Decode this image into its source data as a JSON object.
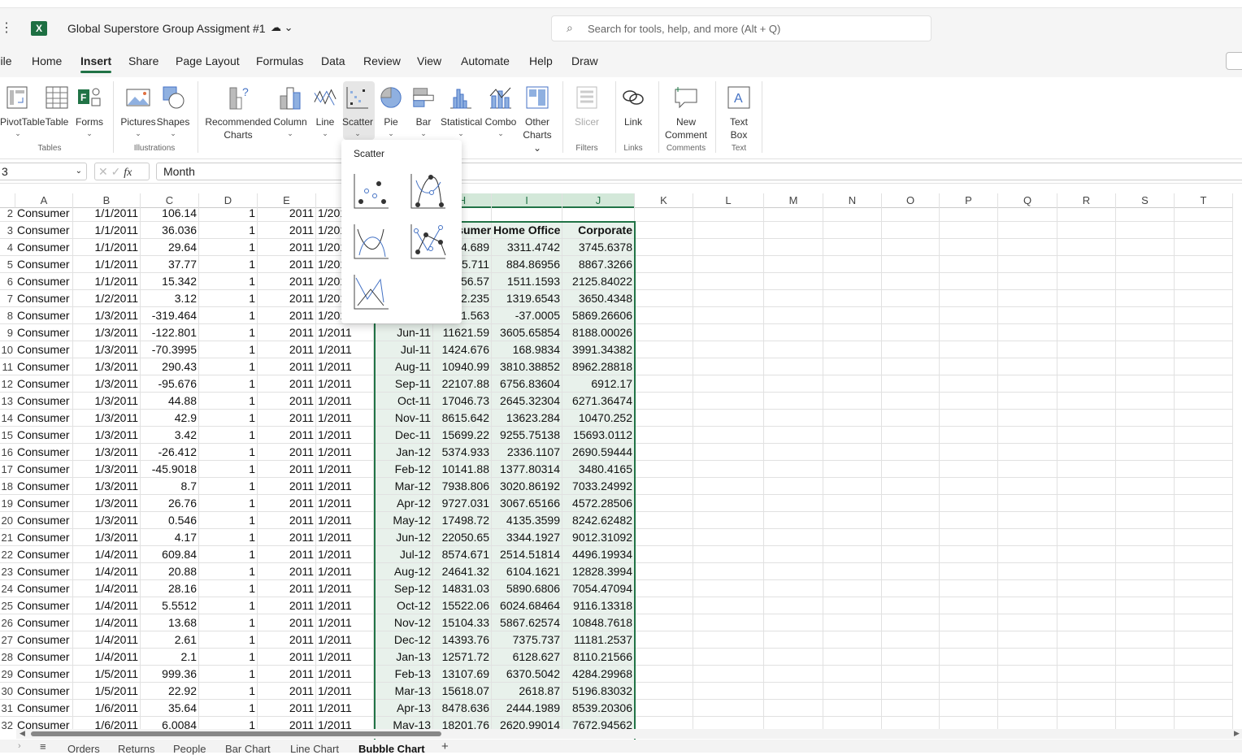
{
  "app": {
    "title": "Global Superstore Group Assigment #1",
    "search_placeholder": "Search for tools, help, and more (Alt + Q)"
  },
  "menu": [
    "File",
    "Home",
    "Insert",
    "Share",
    "Page Layout",
    "Formulas",
    "Data",
    "Review",
    "View",
    "Automate",
    "Help",
    "Draw"
  ],
  "menu_active": "Insert",
  "ribbon": {
    "buttons": [
      {
        "label": "PivotTable",
        "icon": "pivot-table-icon"
      },
      {
        "label": "Table",
        "icon": "table-icon"
      },
      {
        "label": "Forms",
        "icon": "forms-icon"
      },
      {
        "label": "Pictures",
        "icon": "pictures-icon"
      },
      {
        "label": "Shapes",
        "icon": "shapes-icon"
      },
      {
        "label": "Recommended Charts",
        "icon": "recommended-charts-icon"
      },
      {
        "label": "Column",
        "icon": "column-chart-icon"
      },
      {
        "label": "Line",
        "icon": "line-chart-icon"
      },
      {
        "label": "Scatter",
        "icon": "scatter-chart-icon"
      },
      {
        "label": "Pie",
        "icon": "pie-chart-icon"
      },
      {
        "label": "Bar",
        "icon": "bar-chart-icon"
      },
      {
        "label": "Statistical",
        "icon": "statistical-chart-icon"
      },
      {
        "label": "Combo",
        "icon": "combo-chart-icon"
      },
      {
        "label": "Other Charts",
        "icon": "other-charts-icon"
      },
      {
        "label": "Slicer",
        "icon": "slicer-icon"
      },
      {
        "label": "Link",
        "icon": "link-icon"
      },
      {
        "label": "New Comment",
        "icon": "comment-icon"
      },
      {
        "label": "Text Box",
        "icon": "text-box-icon"
      }
    ],
    "groups": [
      "Tables",
      "Illustrations",
      "Filters",
      "Links",
      "Comments",
      "Text"
    ]
  },
  "scatter_menu": {
    "title": "Scatter"
  },
  "formula_bar": {
    "name_box": "3",
    "value": "Month",
    "fx": "fx"
  },
  "columns": [
    "A",
    "B",
    "C",
    "D",
    "E",
    "F",
    "G",
    "H",
    "I",
    "J",
    "K",
    "L",
    "M",
    "N",
    "O",
    "P",
    "Q",
    "R",
    "S",
    "T"
  ],
  "rows": [
    {
      "n": "2",
      "a": "Consumer",
      "b": "1/1/2011",
      "c": "106.14",
      "d": "1",
      "e": "2011",
      "f": "1/2011",
      "g": "",
      "h": "",
      "i": "",
      "j": ""
    },
    {
      "n": "3",
      "a": "Consumer",
      "b": "1/1/2011",
      "c": "36.036",
      "d": "1",
      "e": "2011",
      "f": "1/2011",
      "g": "",
      "h": "Consumer",
      "i": "Home Office",
      "j": "Corporate"
    },
    {
      "n": "4",
      "a": "Consumer",
      "b": "1/1/2011",
      "c": "29.64",
      "d": "1",
      "e": "2011",
      "f": "1/2011",
      "g": "",
      "h": "4.689",
      "i": "3311.4742",
      "j": "3745.6378"
    },
    {
      "n": "5",
      "a": "Consumer",
      "b": "1/1/2011",
      "c": "37.77",
      "d": "1",
      "e": "2011",
      "f": "1/2011",
      "g": "",
      "h": "5.711",
      "i": "884.86956",
      "j": "8867.3266"
    },
    {
      "n": "6",
      "a": "Consumer",
      "b": "1/1/2011",
      "c": "15.342",
      "d": "1",
      "e": "2011",
      "f": "1/2011",
      "g": "",
      "h": "56.57",
      "i": "1511.1593",
      "j": "2125.84022"
    },
    {
      "n": "7",
      "a": "Consumer",
      "b": "1/2/2011",
      "c": "3.12",
      "d": "1",
      "e": "2011",
      "f": "1/2011",
      "g": "",
      "h": "2.235",
      "i": "1319.6543",
      "j": "3650.4348"
    },
    {
      "n": "8",
      "a": "Consumer",
      "b": "1/3/2011",
      "c": "-319.464",
      "d": "1",
      "e": "2011",
      "f": "1/2011",
      "g": "",
      "h": "1.563",
      "i": "-37.0005",
      "j": "5869.26606"
    },
    {
      "n": "9",
      "a": "Consumer",
      "b": "1/3/2011",
      "c": "-122.801",
      "d": "1",
      "e": "2011",
      "f": "1/2011",
      "g": "Jun-11",
      "h": "11621.59",
      "i": "3605.65854",
      "j": "8188.00026"
    },
    {
      "n": "10",
      "a": "Consumer",
      "b": "1/3/2011",
      "c": "-70.3995",
      "d": "1",
      "e": "2011",
      "f": "1/2011",
      "g": "Jul-11",
      "h": "1424.676",
      "i": "168.9834",
      "j": "3991.34382"
    },
    {
      "n": "11",
      "a": "Consumer",
      "b": "1/3/2011",
      "c": "290.43",
      "d": "1",
      "e": "2011",
      "f": "1/2011",
      "g": "Aug-11",
      "h": "10940.99",
      "i": "3810.38852",
      "j": "8962.28818"
    },
    {
      "n": "12",
      "a": "Consumer",
      "b": "1/3/2011",
      "c": "-95.676",
      "d": "1",
      "e": "2011",
      "f": "1/2011",
      "g": "Sep-11",
      "h": "22107.88",
      "i": "6756.83604",
      "j": "6912.17"
    },
    {
      "n": "13",
      "a": "Consumer",
      "b": "1/3/2011",
      "c": "44.88",
      "d": "1",
      "e": "2011",
      "f": "1/2011",
      "g": "Oct-11",
      "h": "17046.73",
      "i": "2645.32304",
      "j": "6271.36474"
    },
    {
      "n": "14",
      "a": "Consumer",
      "b": "1/3/2011",
      "c": "42.9",
      "d": "1",
      "e": "2011",
      "f": "1/2011",
      "g": "Nov-11",
      "h": "8615.642",
      "i": "13623.284",
      "j": "10470.252"
    },
    {
      "n": "15",
      "a": "Consumer",
      "b": "1/3/2011",
      "c": "3.42",
      "d": "1",
      "e": "2011",
      "f": "1/2011",
      "g": "Dec-11",
      "h": "15699.22",
      "i": "9255.75138",
      "j": "15693.0112"
    },
    {
      "n": "16",
      "a": "Consumer",
      "b": "1/3/2011",
      "c": "-26.412",
      "d": "1",
      "e": "2011",
      "f": "1/2011",
      "g": "Jan-12",
      "h": "5374.933",
      "i": "2336.1107",
      "j": "2690.59444"
    },
    {
      "n": "17",
      "a": "Consumer",
      "b": "1/3/2011",
      "c": "-45.9018",
      "d": "1",
      "e": "2011",
      "f": "1/2011",
      "g": "Feb-12",
      "h": "10141.88",
      "i": "1377.80314",
      "j": "3480.4165"
    },
    {
      "n": "18",
      "a": "Consumer",
      "b": "1/3/2011",
      "c": "8.7",
      "d": "1",
      "e": "2011",
      "f": "1/2011",
      "g": "Mar-12",
      "h": "7938.806",
      "i": "3020.86192",
      "j": "7033.24992"
    },
    {
      "n": "19",
      "a": "Consumer",
      "b": "1/3/2011",
      "c": "26.76",
      "d": "1",
      "e": "2011",
      "f": "1/2011",
      "g": "Apr-12",
      "h": "9727.031",
      "i": "3067.65166",
      "j": "4572.28506"
    },
    {
      "n": "20",
      "a": "Consumer",
      "b": "1/3/2011",
      "c": "0.546",
      "d": "1",
      "e": "2011",
      "f": "1/2011",
      "g": "May-12",
      "h": "17498.72",
      "i": "4135.3599",
      "j": "8242.62482"
    },
    {
      "n": "21",
      "a": "Consumer",
      "b": "1/3/2011",
      "c": "4.17",
      "d": "1",
      "e": "2011",
      "f": "1/2011",
      "g": "Jun-12",
      "h": "22050.65",
      "i": "3344.1927",
      "j": "9012.31092"
    },
    {
      "n": "22",
      "a": "Consumer",
      "b": "1/4/2011",
      "c": "609.84",
      "d": "1",
      "e": "2011",
      "f": "1/2011",
      "g": "Jul-12",
      "h": "8574.671",
      "i": "2514.51814",
      "j": "4496.19934"
    },
    {
      "n": "23",
      "a": "Consumer",
      "b": "1/4/2011",
      "c": "20.88",
      "d": "1",
      "e": "2011",
      "f": "1/2011",
      "g": "Aug-12",
      "h": "24641.32",
      "i": "6104.1621",
      "j": "12828.3994"
    },
    {
      "n": "24",
      "a": "Consumer",
      "b": "1/4/2011",
      "c": "28.16",
      "d": "1",
      "e": "2011",
      "f": "1/2011",
      "g": "Sep-12",
      "h": "14831.03",
      "i": "5890.6806",
      "j": "7054.47094"
    },
    {
      "n": "25",
      "a": "Consumer",
      "b": "1/4/2011",
      "c": "5.5512",
      "d": "1",
      "e": "2011",
      "f": "1/2011",
      "g": "Oct-12",
      "h": "15522.06",
      "i": "6024.68464",
      "j": "9116.13318"
    },
    {
      "n": "26",
      "a": "Consumer",
      "b": "1/4/2011",
      "c": "13.68",
      "d": "1",
      "e": "2011",
      "f": "1/2011",
      "g": "Nov-12",
      "h": "15104.33",
      "i": "5867.62574",
      "j": "10848.7618"
    },
    {
      "n": "27",
      "a": "Consumer",
      "b": "1/4/2011",
      "c": "2.61",
      "d": "1",
      "e": "2011",
      "f": "1/2011",
      "g": "Dec-12",
      "h": "14393.76",
      "i": "7375.737",
      "j": "11181.2537"
    },
    {
      "n": "28",
      "a": "Consumer",
      "b": "1/4/2011",
      "c": "2.1",
      "d": "1",
      "e": "2011",
      "f": "1/2011",
      "g": "Jan-13",
      "h": "12571.72",
      "i": "6128.627",
      "j": "8110.21566"
    },
    {
      "n": "29",
      "a": "Consumer",
      "b": "1/5/2011",
      "c": "999.36",
      "d": "1",
      "e": "2011",
      "f": "1/2011",
      "g": "Feb-13",
      "h": "13107.69",
      "i": "6370.5042",
      "j": "4284.29968"
    },
    {
      "n": "30",
      "a": "Consumer",
      "b": "1/5/2011",
      "c": "22.92",
      "d": "1",
      "e": "2011",
      "f": "1/2011",
      "g": "Mar-13",
      "h": "15618.07",
      "i": "2618.87",
      "j": "5196.83032"
    },
    {
      "n": "31",
      "a": "Consumer",
      "b": "1/6/2011",
      "c": "35.64",
      "d": "1",
      "e": "2011",
      "f": "1/2011",
      "g": "Apr-13",
      "h": "8478.636",
      "i": "2444.1989",
      "j": "8539.20306"
    },
    {
      "n": "32",
      "a": "Consumer",
      "b": "1/6/2011",
      "c": "6.0084",
      "d": "1",
      "e": "2011",
      "f": "1/2011",
      "g": "May-13",
      "h": "18201.76",
      "i": "2620.99014",
      "j": "7672.94562"
    }
  ],
  "sheets": [
    "Orders",
    "Returns",
    "People",
    "Bar Chart",
    "Line Chart",
    "Bubble Chart"
  ],
  "active_sheet": "Bubble Chart",
  "colors": {
    "accent": "#217346",
    "selection_fill": "#e8f1eb",
    "chart_blue": "#4472c4"
  }
}
